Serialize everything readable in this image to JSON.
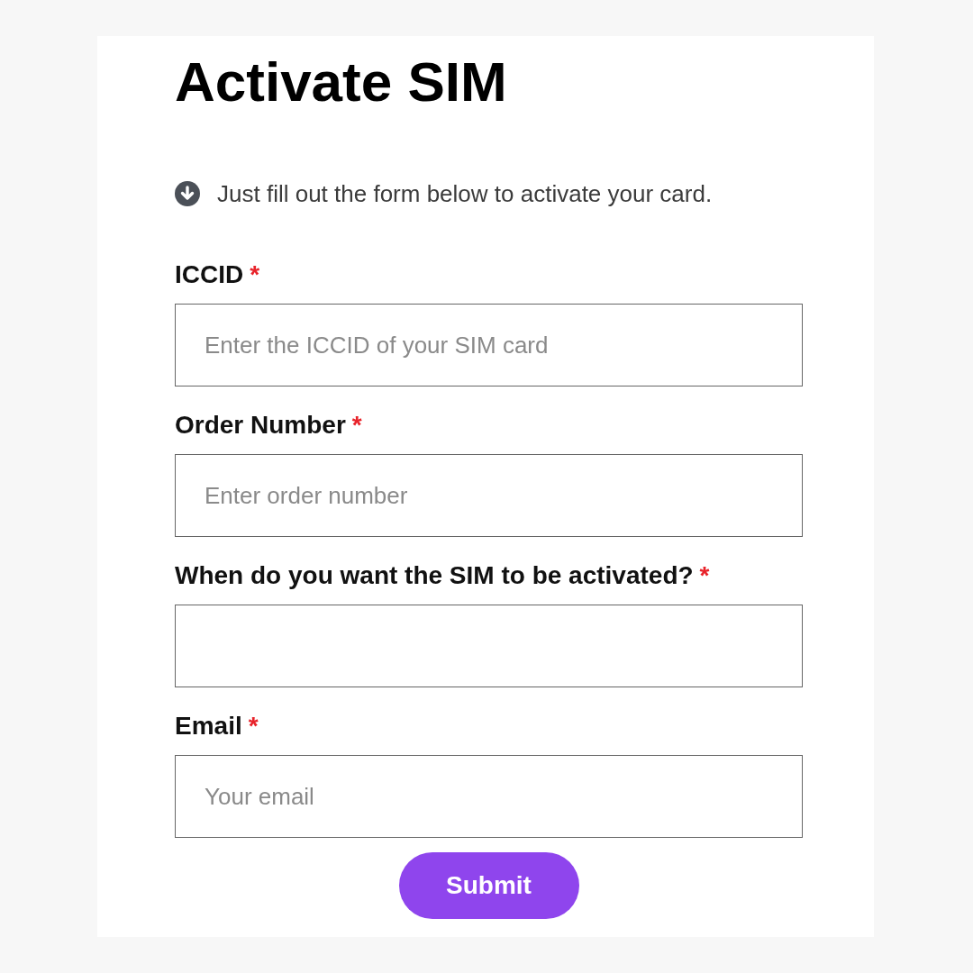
{
  "title": "Activate SIM",
  "intro": {
    "text": "Just fill out the form below to activate your card."
  },
  "fields": [
    {
      "label": "ICCID",
      "required_mark": "*",
      "placeholder": "Enter the ICCID of your SIM card"
    },
    {
      "label": "Order Number",
      "required_mark": "*",
      "placeholder": "Enter order number"
    },
    {
      "label": "When do you want the SIM to be activated?",
      "required_mark": "*"
    },
    {
      "label": "Email",
      "required_mark": "*",
      "placeholder": "Your email"
    }
  ],
  "submit_button": {
    "label": "Submit"
  }
}
